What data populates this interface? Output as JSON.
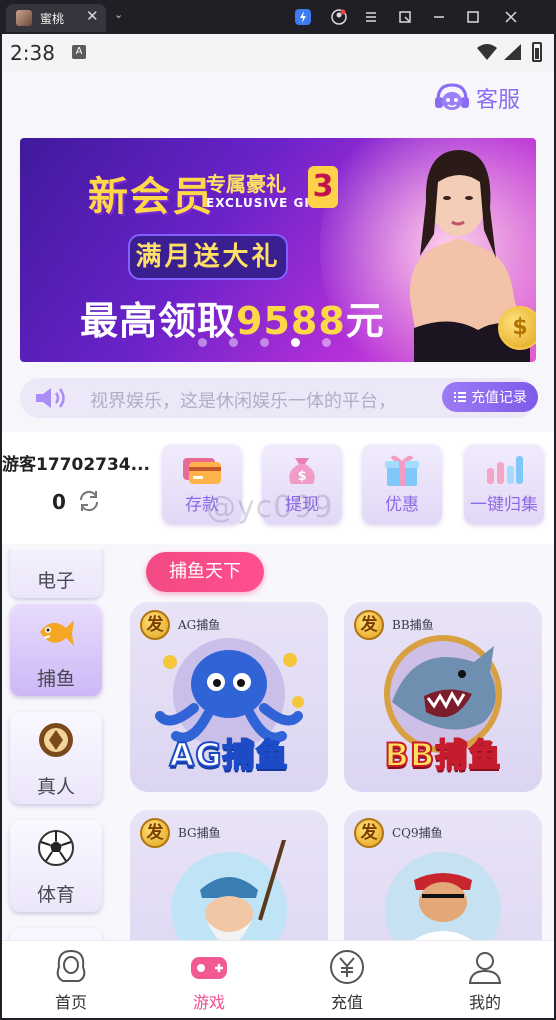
{
  "browser": {
    "tab_title": "蜜桃",
    "close_glyph": "✕",
    "dropdown_glyph": "⌄"
  },
  "status_bar": {
    "time": "2:38",
    "notification_glyph": "A"
  },
  "header": {
    "customer_service_label": "客服"
  },
  "banner": {
    "title": "新会员",
    "subtitle": "专属豪礼",
    "subtitle_en": "EXCLUSIVE GIFT",
    "number": "3",
    "pill_text": "满月送大礼",
    "big_text_prefix": "最高领取",
    "big_text_amount": "9588",
    "big_text_suffix": "元",
    "coin_glyph": "$",
    "page_count": 5,
    "active_page": 4
  },
  "notice": {
    "text": "视界娱乐，这是休闲娱乐一体的平台，",
    "recharge_label": "充值记录"
  },
  "user": {
    "name": "游客17702734...",
    "balance": "0"
  },
  "actions": [
    {
      "label": "存款",
      "icon": "deposit-card-icon"
    },
    {
      "label": "提现",
      "icon": "withdraw-bag-icon"
    },
    {
      "label": "优惠",
      "icon": "gift-box-icon"
    },
    {
      "label": "一键归集",
      "icon": "bar-collect-icon"
    }
  ],
  "watermark": "@yc099",
  "sidebar": {
    "items": [
      {
        "label": "电子",
        "icon": "slot-icon"
      },
      {
        "label": "捕鱼",
        "icon": "fish-icon",
        "active": true
      },
      {
        "label": "真人",
        "icon": "casino-chip-icon"
      },
      {
        "label": "体育",
        "icon": "soccer-ball-icon"
      }
    ]
  },
  "section": {
    "chip_label": "捕鱼天下"
  },
  "games": [
    {
      "badge": "发",
      "tag": "AG捕鱼",
      "logo": "AG捕鱼",
      "art": "octopus"
    },
    {
      "badge": "发",
      "tag": "BB捕鱼",
      "logo": "BB捕鱼",
      "art": "shark"
    },
    {
      "badge": "发",
      "tag": "BG捕鱼",
      "logo": "",
      "art": "fisherman"
    },
    {
      "badge": "发",
      "tag": "CQ9捕鱼",
      "logo": "",
      "art": "pirate"
    }
  ],
  "bottom_nav": [
    {
      "label": "首页",
      "icon": "home-woman-icon"
    },
    {
      "label": "游戏",
      "icon": "gamepad-icon",
      "active": true
    },
    {
      "label": "充值",
      "icon": "yen-coin-icon"
    },
    {
      "label": "我的",
      "icon": "user-profile-icon"
    }
  ],
  "colors": {
    "brand_purple": "#8a6cf5",
    "accent_pink": "#f04e8f"
  }
}
